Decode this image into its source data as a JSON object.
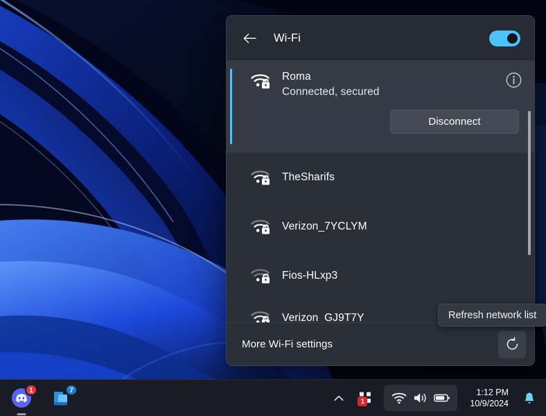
{
  "panel": {
    "title": "Wi-Fi",
    "back_icon": "back-arrow-icon",
    "toggle_state": "on",
    "accent_color": "#4cc2ff",
    "background_color": "#2b2f38",
    "networks": [
      {
        "name": "Roma",
        "status": "Connected, secured",
        "signal": 3,
        "secured": true,
        "expanded": true,
        "selected": true,
        "info_icon": "info-circle-icon",
        "action_label": "Disconnect"
      },
      {
        "name": "TheSharifs",
        "status": "",
        "signal": 2,
        "secured": true,
        "expanded": false,
        "selected": false
      },
      {
        "name": "Verizon_7YCLYM",
        "status": "",
        "signal": 1,
        "secured": true,
        "expanded": false,
        "selected": false
      },
      {
        "name": "Fios-HLxp3",
        "status": "",
        "signal": 0,
        "secured": true,
        "expanded": false,
        "selected": false
      },
      {
        "name": "Verizon_GJ9T7Y",
        "status": "",
        "signal": 1,
        "secured": true,
        "expanded": false,
        "selected": false,
        "clipped": true
      }
    ],
    "footer": {
      "more_settings_label": "More Wi-Fi settings",
      "refresh_icon": "refresh-icon"
    }
  },
  "tooltip": {
    "text": "Refresh network list"
  },
  "taskbar": {
    "apps": [
      {
        "name": "discord",
        "badge": "1",
        "badge_color": "#e8343f",
        "running": true
      },
      {
        "name": "file-explorer",
        "badge": "7",
        "badge_color": "#1a7fd4",
        "running": false
      }
    ],
    "tray": {
      "chevron_icon": "chevron-up-icon",
      "teams_icon": "teams-icon",
      "teams_badge": "1",
      "quick_settings": {
        "wifi_icon": "wifi-icon",
        "volume_icon": "speaker-icon",
        "battery_icon": "battery-icon"
      },
      "time": "1:12 PM",
      "date": "10/9/2024",
      "notification_icon": "bell-icon"
    }
  }
}
